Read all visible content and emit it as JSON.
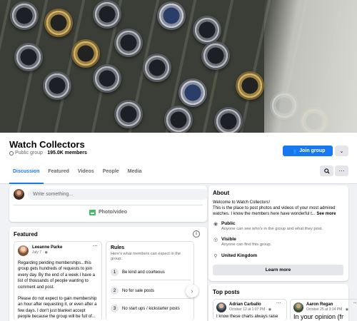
{
  "cover": {
    "alt": "Watch collection cover photo"
  },
  "group": {
    "name": "Watch Collectors",
    "privacy": "Public group",
    "members": "195.0K members",
    "join_label": "Join group"
  },
  "tabs": [
    "Discussion",
    "Featured",
    "Videos",
    "People",
    "Media"
  ],
  "composer": {
    "placeholder": "Write something...",
    "photo_label": "Photo/video"
  },
  "featured": {
    "title": "Featured",
    "post": {
      "author": "Leeanne Parke",
      "date": "July 7 · ",
      "paragraph1": "Regarding pending memberships...this group gets hundreds of requests to join every day. By the end of a week I have a list of thousands of people wanting to comment and post.",
      "paragraph2": "Please do not expect to gain membership an hour after requesting it, or even after a few days. I don't just blanket accept people because the group will be full of..."
    },
    "rules": {
      "title": "Rules",
      "subtitle": "Here's what members can expect in the group.",
      "items": [
        {
          "num": "1",
          "text": "Be kind and courteous"
        },
        {
          "num": "2",
          "text": "No for sale posts"
        },
        {
          "num": "3",
          "text": "No start ups / kickstarter posts"
        }
      ]
    }
  },
  "about": {
    "title": "About",
    "description": "Welcome to Watch Collectors!\nThis is the place to post photos and videos of your most admired watches. I know the members here have wonderful t...",
    "see_more": "See more",
    "public": {
      "title": "Public",
      "sub": "Anyone can see who's in the group and what they post."
    },
    "visible": {
      "title": "Visible",
      "sub": "Anyone can find this group."
    },
    "location": "United Kingdom",
    "learn_more": "Learn more"
  },
  "top_posts": {
    "title": "Top posts",
    "posts": [
      {
        "author": "Adrian Carballo",
        "date": "October 12 at 1:07 PM · ",
        "text": "I know these charts always raise"
      },
      {
        "author": "Aaron Regan",
        "date": "October 25 at 3:14 PM · ",
        "text": "In your opinion (fr"
      }
    ]
  },
  "colors": {
    "accent": "#1877f2",
    "background": "#f0f2f5"
  }
}
